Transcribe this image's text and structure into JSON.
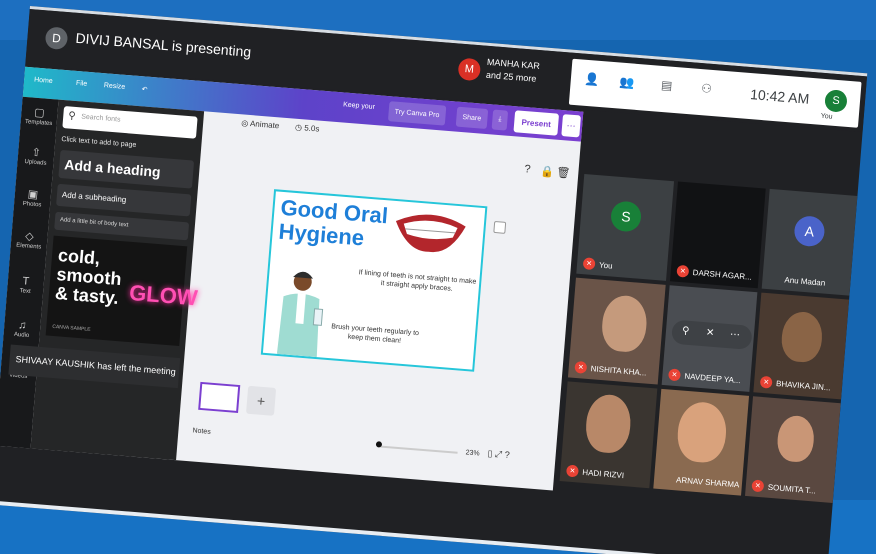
{
  "meet": {
    "presenter_initial": "D",
    "presenter_text": "DIVIJ BANSAL is presenting",
    "notice_avatar": "M",
    "notice_name": "MANHA KAR",
    "notice_more": "and 25 more",
    "clock": "10:42 AM",
    "self_initial": "S",
    "self_label": "You",
    "left_message": "SHIVAAY KAUSHIK has left the meeting"
  },
  "canva": {
    "home": "Home",
    "file": "File",
    "resize": "Resize",
    "header_text": "Keep your",
    "try_pro": "Try Canva Pro",
    "share": "Share",
    "present": "Present",
    "animate": "Animate",
    "duration": "5.0s",
    "rail": [
      "Templates",
      "Uploads",
      "Photos",
      "Elements",
      "Text",
      "Audio",
      "Videos"
    ],
    "search_placeholder": "Search fonts",
    "hint": "Click text to add to page",
    "add_heading": "Add a heading",
    "add_subheading": "Add a subheading",
    "add_body": "Add a little bit of body text",
    "promo_words": "cold, smooth & tasty.",
    "promo_glow": "GLOW",
    "promo_tiny": "CANVA SAMPLE",
    "slide_title": "Good Oral Hygiene",
    "slide_braces": "If lining of teeth is not straight to make it straight apply braces.",
    "slide_brush": "Brush your teeth regularly to keep them clean!",
    "notes": "Notes",
    "zoom": "23%"
  },
  "participants": [
    {
      "name": "You",
      "initial": "S",
      "color": "#188038"
    },
    {
      "name": "DARSH AGAR...",
      "initial": "",
      "color": "#202124"
    },
    {
      "name": "Anu Madan",
      "initial": "A",
      "color": "#4a63c9"
    },
    {
      "name": "NISHITA KHA...",
      "initial": "",
      "color": "#5a4a42"
    },
    {
      "name": "NAVDEEP YA...",
      "initial": "",
      "color": "#3c4043"
    },
    {
      "name": "BHAVIKA JIN...",
      "initial": "",
      "color": "#4a3a30"
    },
    {
      "name": "HADI RIZVI",
      "initial": "",
      "color": "#3a3530"
    },
    {
      "name": "ARNAV SHARMA",
      "initial": "",
      "color": "#8a6a50"
    },
    {
      "name": "SOUMITA T...",
      "initial": "",
      "color": "#5a4840"
    }
  ],
  "colors": {
    "canva_header": "#7b3fd0",
    "slide_title": "#1e7fd8",
    "mute_red": "#ea4335",
    "meet_bg": "#202124"
  }
}
